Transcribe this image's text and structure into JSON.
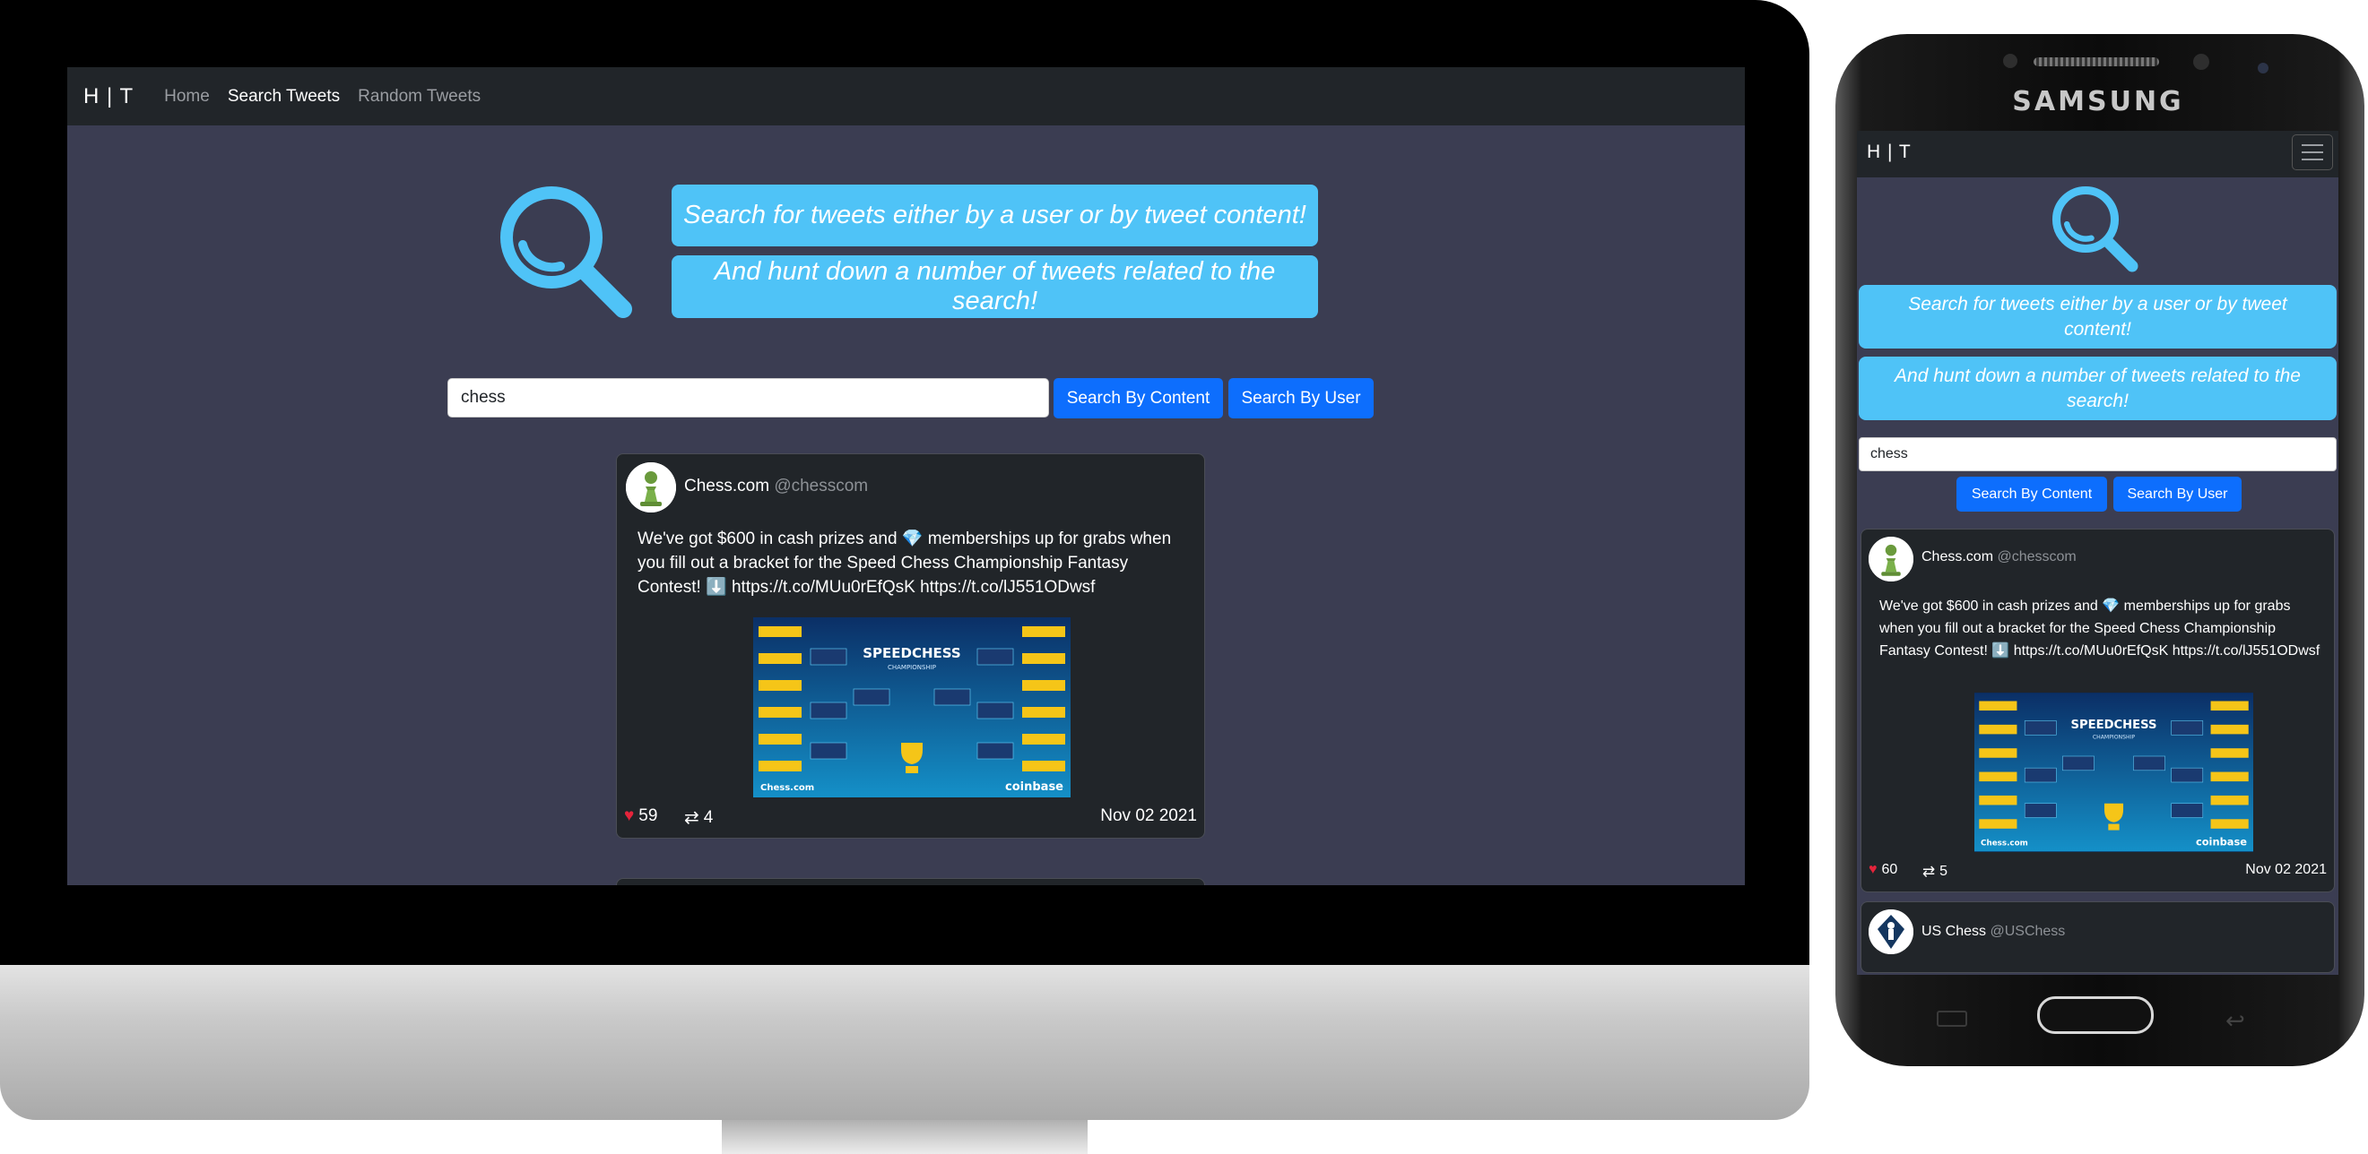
{
  "desktop": {
    "nav": {
      "brand": "H | T",
      "links": [
        "Home",
        "Search Tweets",
        "Random Tweets"
      ],
      "active_link": "Search Tweets"
    },
    "hero": {
      "line1": "Search for tweets either by a user or by tweet content!",
      "line2": "And hunt down a number of tweets related to the search!",
      "icon": "magnifier-icon"
    },
    "search": {
      "value": "chess",
      "by_content_label": "Search By Content",
      "by_user_label": "Search By User"
    },
    "tweet": {
      "name": "Chess.com",
      "handle": "@chesscom",
      "text": "We've got $600 in cash prizes and 💎 memberships up for grabs when you fill out a bracket for the Speed Chess Championship Fantasy Contest! ⬇️ https://t.co/MUu0rEfQsK https://t.co/lJ551ODwsf",
      "image_title": "SPEEDCHESS",
      "image_subtitle": "CHAMPIONSHIP",
      "image_brand_left": "Chess.com",
      "image_brand_right": "coinbase",
      "likes": "59",
      "retweets": "4",
      "date": "Nov 02 2021"
    }
  },
  "phone": {
    "device_brand": "SAMSUNG",
    "nav": {
      "brand": "H | T",
      "menu_icon": "hamburger-icon"
    },
    "hero": {
      "line1": "Search for tweets either by a user or by tweet content!",
      "line2": "And hunt down a number of tweets related to the search!"
    },
    "search": {
      "value": "chess",
      "by_content_label": "Search By Content",
      "by_user_label": "Search By User"
    },
    "tweets": [
      {
        "name": "Chess.com",
        "handle": "@chesscom",
        "text": "We've got $600 in cash prizes and 💎 memberships up for grabs when you fill out a bracket for the Speed Chess Championship Fantasy Contest! ⬇️ https://t.co/MUu0rEfQsK https://t.co/lJ551ODwsf",
        "likes": "60",
        "retweets": "5",
        "date": "Nov 02 2021"
      },
      {
        "name": "US Chess",
        "handle": "@USChess"
      }
    ]
  },
  "colors": {
    "page_bg": "#3b3d52",
    "navbar": "#212529",
    "pill": "#4fc3f7",
    "button": "#0d6efd",
    "card": "#212529"
  }
}
